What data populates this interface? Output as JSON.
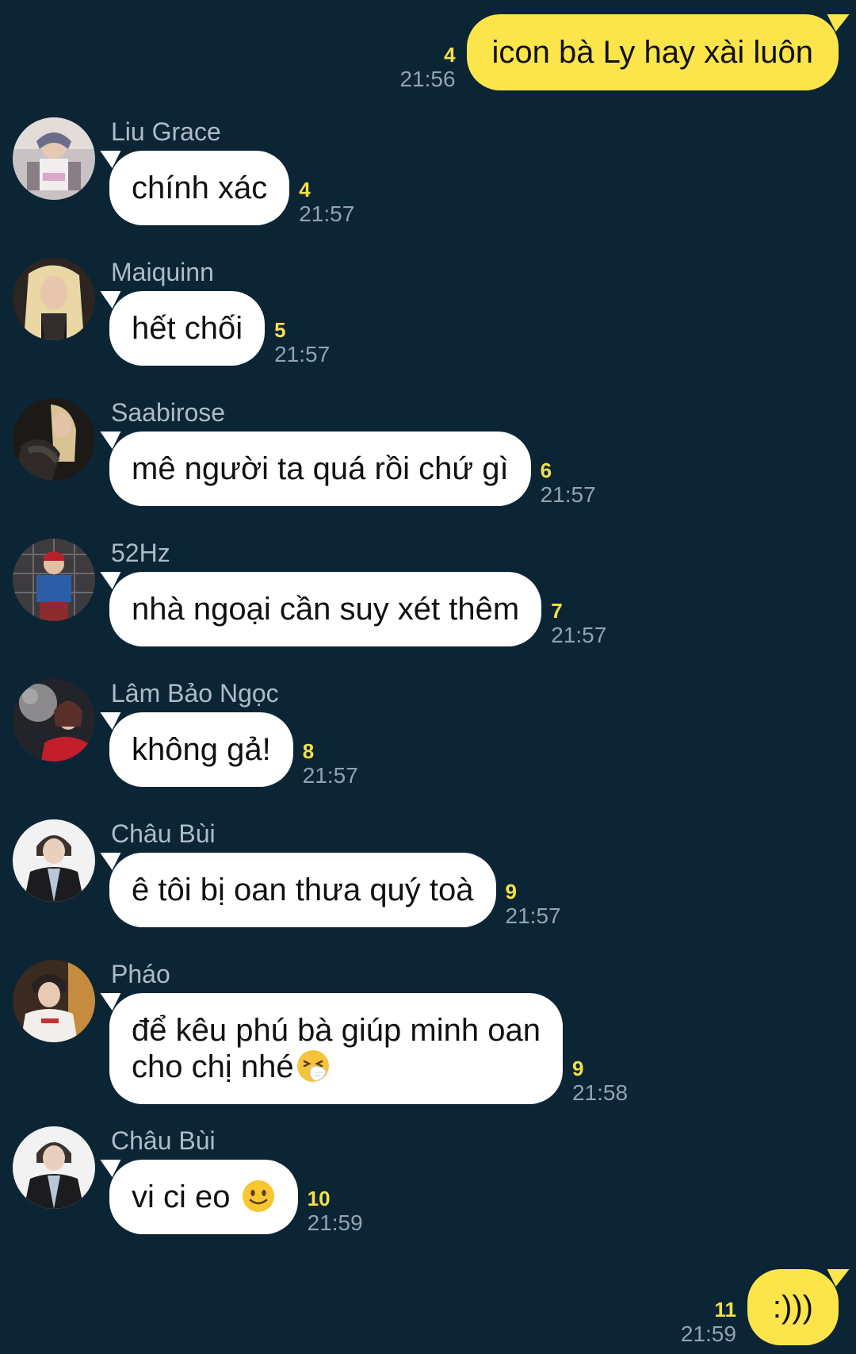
{
  "messages": [
    {
      "dir": "out",
      "text": "icon bà Ly hay xài luôn",
      "count": "4",
      "time": "21:56"
    },
    {
      "dir": "in",
      "sender": "Liu Grace",
      "text": "chính xác",
      "count": "4",
      "time": "21:57"
    },
    {
      "dir": "in",
      "sender": "Maiquinn",
      "text": "hết chối",
      "count": "5",
      "time": "21:57"
    },
    {
      "dir": "in",
      "sender": "Saabirose",
      "text": "mê người ta quá rồi chứ gì",
      "count": "6",
      "time": "21:57"
    },
    {
      "dir": "in",
      "sender": "52Hz",
      "text": "nhà ngoại cần suy xét thêm",
      "count": "7",
      "time": "21:57"
    },
    {
      "dir": "in",
      "sender": "Lâm Bảo Ngọc",
      "text": "không gả!",
      "count": "8",
      "time": "21:57"
    },
    {
      "dir": "in",
      "sender": "Châu Bùi",
      "text": "ê tôi bị oan thưa quý toà",
      "count": "9",
      "time": "21:57"
    },
    {
      "dir": "in",
      "sender": "Pháo",
      "text_line1": "để kêu phú bà giúp minh oan",
      "text_line2": "cho chị nhé",
      "emoji": "sneezing-face-emoji",
      "count": "9",
      "time": "21:58"
    },
    {
      "dir": "in",
      "sender": "Châu Bùi",
      "text": "vi ci eo",
      "emoji": "smiling-face-emoji",
      "count": "10",
      "time": "21:59"
    },
    {
      "dir": "out",
      "text": ":)))",
      "count": "11",
      "time": "21:59"
    }
  ],
  "colors": {
    "background": "#0b2535",
    "outgoing_bubble": "#fbe54b",
    "incoming_bubble": "#ffffff",
    "read_count": "#f5e04a",
    "time": "#93a3ae",
    "sender": "#aebcc6"
  }
}
